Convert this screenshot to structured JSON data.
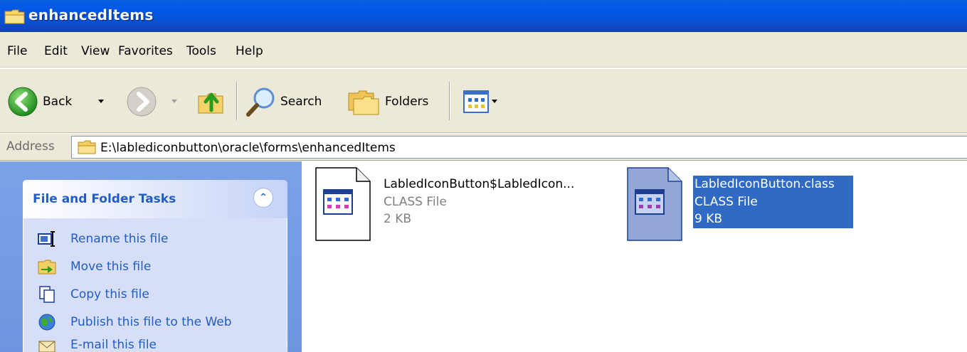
{
  "window": {
    "title": "enhancedItems"
  },
  "menu": {
    "items": [
      "File",
      "Edit",
      "View",
      "Favorites",
      "Tools",
      "Help"
    ]
  },
  "toolbar": {
    "back_label": "Back",
    "search_label": "Search",
    "folders_label": "Folders"
  },
  "address": {
    "label": "Address",
    "path": "E:\\lablediconbutton\\oracle\\forms\\enhancedItems"
  },
  "tasks": {
    "title": "File and Folder Tasks",
    "items": [
      {
        "label": "Rename this file",
        "icon": "rename-icon"
      },
      {
        "label": "Move this file",
        "icon": "move-icon"
      },
      {
        "label": "Copy this file",
        "icon": "copy-icon"
      },
      {
        "label": "Publish this file to the Web",
        "icon": "publish-icon"
      },
      {
        "label": "E-mail this file",
        "icon": "email-icon"
      }
    ]
  },
  "files": [
    {
      "name": "LabledIconButton$LabledIcon...",
      "type": "CLASS File",
      "size": "2 KB",
      "selected": false
    },
    {
      "name": "LabledIconButton.class",
      "type": "CLASS File",
      "size": "9 KB",
      "selected": true
    }
  ],
  "colors": {
    "titlebar": "#0058e6",
    "selection": "#316ac5",
    "task_link": "#215dc6",
    "chrome": "#ece9d8"
  }
}
